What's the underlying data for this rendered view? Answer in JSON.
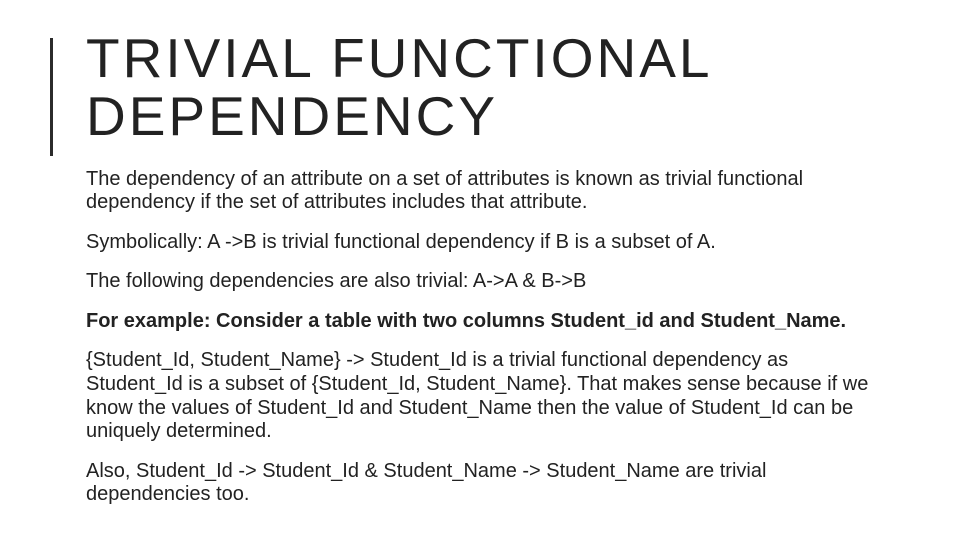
{
  "title": "TRIVIAL FUNCTIONAL DEPENDENCY",
  "paragraphs": {
    "p1": "The dependency of an attribute on a set of attributes is known as trivial functional dependency if the set of attributes includes that attribute.",
    "p2": "Symbolically: A ->B is trivial functional dependency if B is a subset of A.",
    "p3": "The following dependencies are also trivial: A->A & B->B",
    "p4": "For example: Consider a table with two columns Student_id and Student_Name.",
    "p5": "{Student_Id, Student_Name} -> Student_Id is a trivial functional dependency as Student_Id is a subset of {Student_Id, Student_Name}.  That makes sense because if we know the values of Student_Id and Student_Name then the value of Student_Id can be uniquely determined.",
    "p6": "Also, Student_Id -> Student_Id & Student_Name -> Student_Name are trivial dependencies too."
  }
}
